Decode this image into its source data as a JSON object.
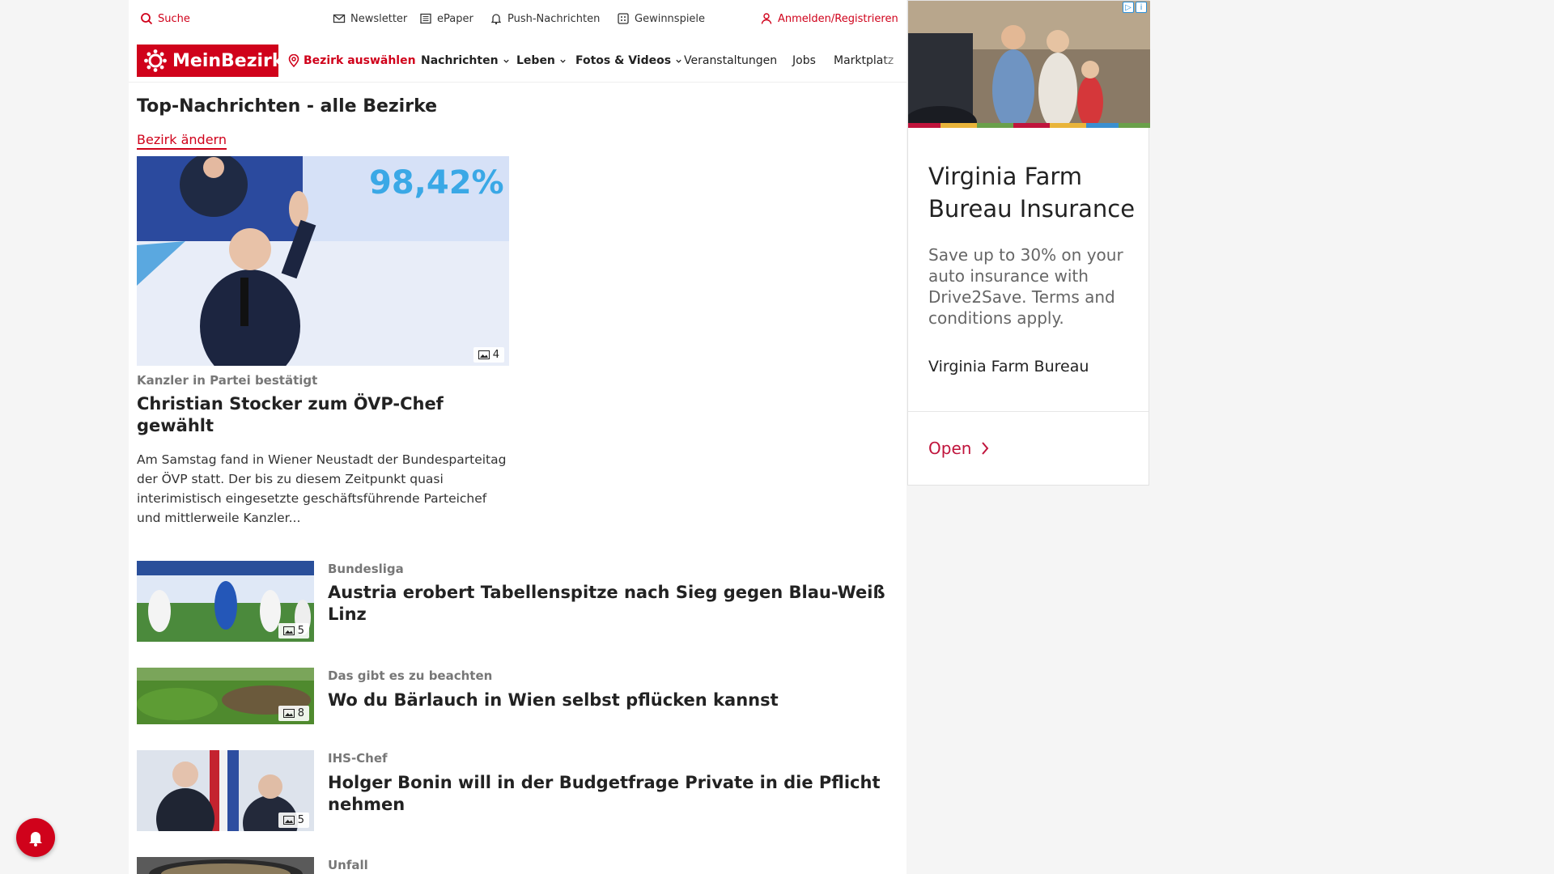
{
  "utility_bar": {
    "search": "Suche",
    "newsletter": "Newsletter",
    "epaper": "ePaper",
    "push": "Push-Nachrichten",
    "gewinnspiele": "Gewinnspiele",
    "login": "Anmelden/Registrieren"
  },
  "nav": {
    "logo": "MeinBezirk",
    "district_select": "Bezirk auswählen",
    "items": [
      "Nachrichten",
      "Leben",
      "Fotos & Videos",
      "Veranstaltungen",
      "Jobs",
      "Marktplatz"
    ]
  },
  "main": {
    "section_title": "Top-Nachrichten - alle Bezirke",
    "change_district": "Bezirk ändern",
    "hero": {
      "image_overlay_text": "98,42%",
      "image_count": "4",
      "kicker": "Kanzler in Partei bestätigt",
      "headline": "Christian Stocker zum ÖVP-Chef gewählt",
      "teaser": "Am Samstag fand in Wiener Neustadt der Bundesparteitag der ÖVP statt. Der bis zu diesem Zeitpunkt quasi interimistisch eingesetzte geschäftsführende Parteichef und mittlerweile Kanzler..."
    },
    "articles": [
      {
        "kicker": "Bundesliga",
        "headline": "Austria erobert Tabellenspitze nach Sieg gegen Blau-Weiß Linz",
        "image_count": "5"
      },
      {
        "kicker": "Das gibt es zu beachten",
        "headline": "Wo du Bärlauch in Wien selbst pflücken kannst",
        "image_count": "8"
      },
      {
        "kicker": "IHS-Chef",
        "headline": "Holger Bonin will in der Budgetfrage Private in die Pflicht nehmen",
        "image_count": "5"
      },
      {
        "kicker": "Unfall",
        "headline": "",
        "image_count": ""
      }
    ]
  },
  "ad": {
    "title": "Virginia Farm Bureau Insurance",
    "body": "Save up to 30% on your auto insurance with Drive2Save. Terms and conditions apply.",
    "advertiser": "Virginia Farm Bureau",
    "cta": "Open"
  },
  "colors": {
    "brand": "#d0021b",
    "ad_cta": "#c0143c"
  }
}
